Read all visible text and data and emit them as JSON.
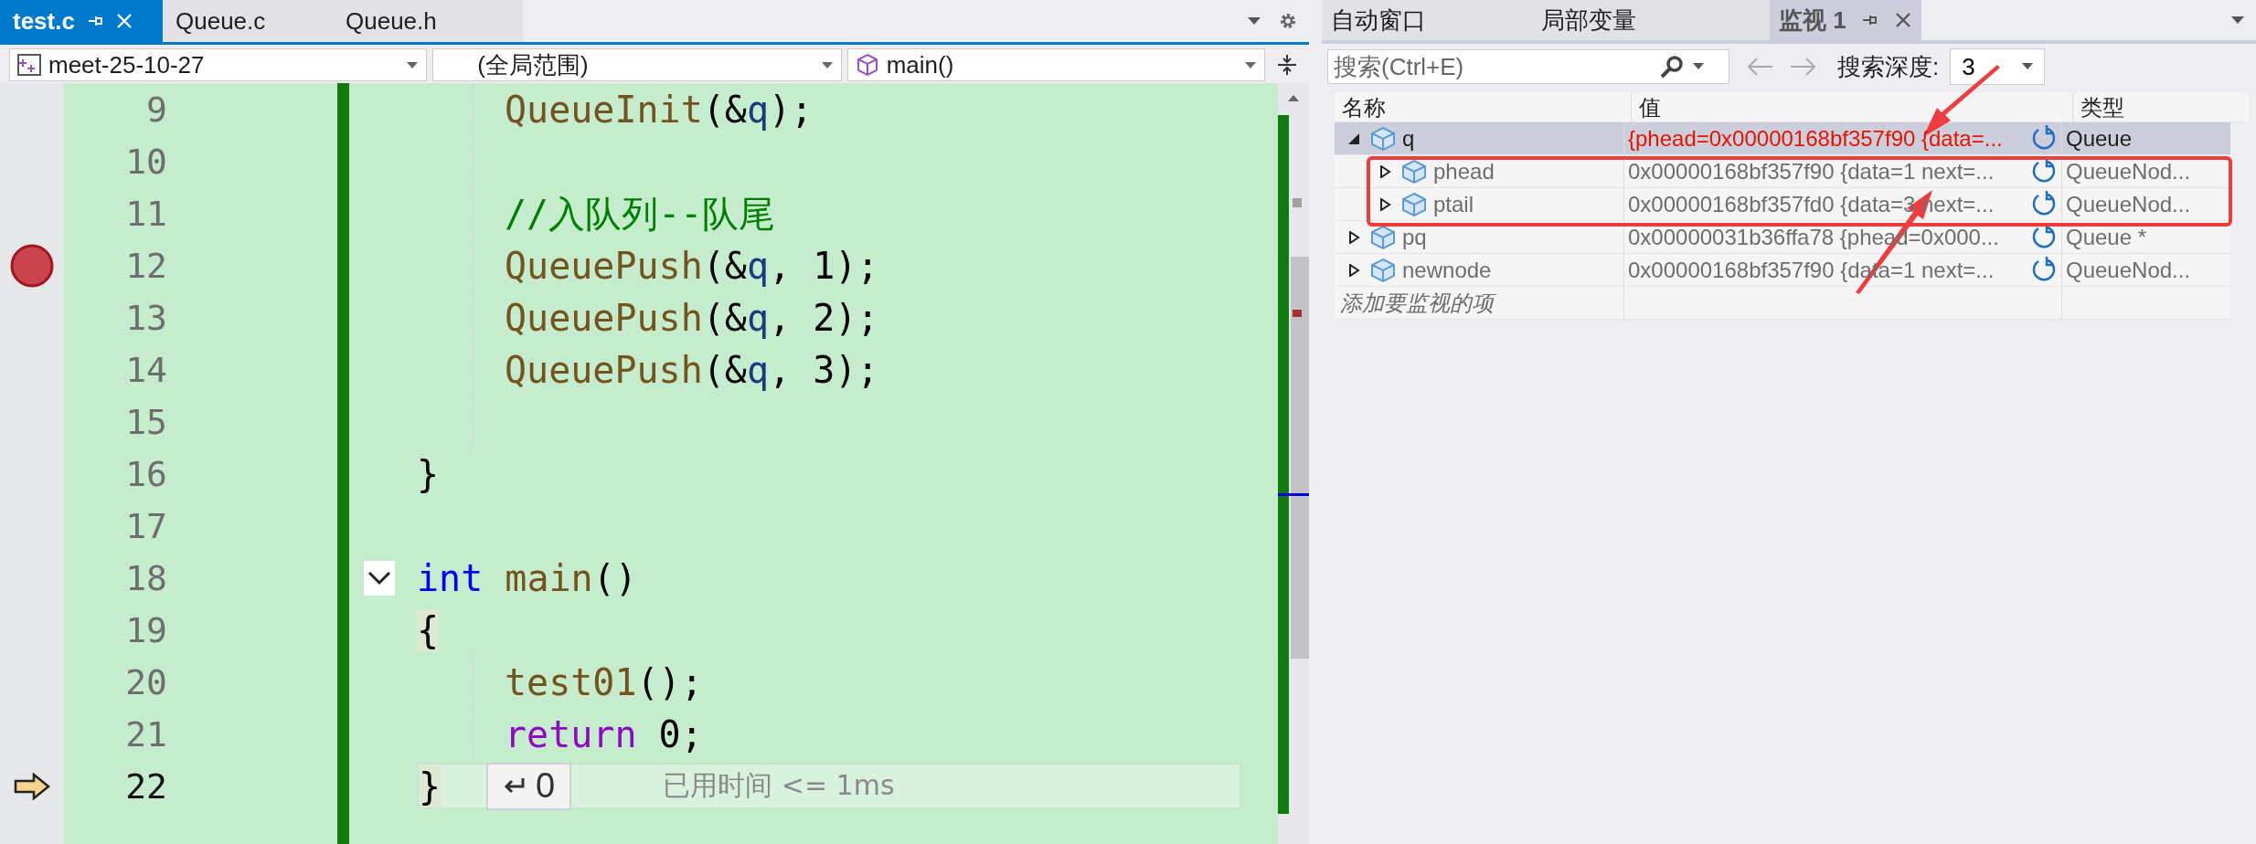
{
  "editor": {
    "tabs": [
      {
        "label": "test.c",
        "selected": true
      },
      {
        "label": "Queue.c",
        "selected": false
      },
      {
        "label": "Queue.h",
        "selected": false
      }
    ],
    "nav": {
      "project": "meet-25-10-27",
      "scope": "(全局范围)",
      "member": "main()"
    },
    "lines": [
      {
        "number": "9",
        "indented": true,
        "tokens": [
          {
            "kind": "func",
            "text": "QueueInit"
          },
          {
            "kind": "plain",
            "text": "(&"
          },
          {
            "kind": "var",
            "text": "q"
          },
          {
            "kind": "plain",
            "text": ");"
          }
        ]
      },
      {
        "number": "10",
        "indented": true
      },
      {
        "number": "11",
        "indented": true,
        "tokens": [
          {
            "kind": "comment",
            "text": "//入队列--队尾"
          }
        ]
      },
      {
        "number": "12",
        "indented": true,
        "breakpoint": true,
        "tokens": [
          {
            "kind": "func",
            "text": "QueuePush"
          },
          {
            "kind": "plain",
            "text": "(&"
          },
          {
            "kind": "var",
            "text": "q"
          },
          {
            "kind": "plain",
            "text": ", 1);"
          }
        ]
      },
      {
        "number": "13",
        "indented": true,
        "tokens": [
          {
            "kind": "func",
            "text": "QueuePush"
          },
          {
            "kind": "plain",
            "text": "(&"
          },
          {
            "kind": "var",
            "text": "q"
          },
          {
            "kind": "plain",
            "text": ", 2);"
          }
        ]
      },
      {
        "number": "14",
        "indented": true,
        "tokens": [
          {
            "kind": "func",
            "text": "QueuePush"
          },
          {
            "kind": "plain",
            "text": "(&"
          },
          {
            "kind": "var",
            "text": "q"
          },
          {
            "kind": "plain",
            "text": ", 3);"
          }
        ]
      },
      {
        "number": "15",
        "indented": true
      },
      {
        "number": "16",
        "indented": false,
        "tokens": [
          {
            "kind": "plain",
            "text": "}"
          }
        ]
      },
      {
        "number": "17",
        "indented": false
      },
      {
        "number": "18",
        "indented": false,
        "collapsible": true,
        "tokens": [
          {
            "kind": "keyword",
            "text": "int"
          },
          {
            "kind": "func",
            "text": "main",
            "spaced": true
          },
          {
            "kind": "plain",
            "text": "()"
          }
        ]
      },
      {
        "number": "19",
        "indented": false,
        "tokens": [
          {
            "kind": "brace",
            "text": "{"
          }
        ]
      },
      {
        "number": "20",
        "indented": true,
        "tokens": [
          {
            "kind": "func",
            "text": "test01"
          },
          {
            "kind": "plain",
            "text": "();"
          }
        ]
      },
      {
        "number": "21",
        "indented": true,
        "tokens": [
          {
            "kind": "control",
            "text": "return"
          },
          {
            "kind": "plain",
            "text": " 0;"
          }
        ]
      },
      {
        "number": "22",
        "indented": false,
        "current": true,
        "tokens": [
          {
            "kind": "brace",
            "text": "}"
          }
        ],
        "return_value": "0",
        "elapsed": "已用时间 <= 1ms"
      }
    ]
  },
  "watch": {
    "tabs": [
      {
        "label": "自动窗口",
        "selected": false
      },
      {
        "label": "局部变量",
        "selected": false
      },
      {
        "label": "监视 1",
        "selected": true
      }
    ],
    "search": {
      "placeholder": "搜索(Ctrl+E)"
    },
    "depth_label": "搜索深度:",
    "depth": "3",
    "columns": [
      "名称",
      "值",
      "类型"
    ],
    "rows": [
      {
        "name": "q",
        "value": "{phead=0x00000168bf357f90 {data=...",
        "type": "Queue",
        "expanded": true,
        "selected": true,
        "changed": true,
        "children": [
          {
            "name": "phead",
            "value": "0x00000168bf357f90 {data=1 next=...",
            "type": "QueueNod...",
            "expanded": false,
            "selected": false,
            "changed": false
          },
          {
            "name": "ptail",
            "value": "0x00000168bf357fd0 {data=3 next=...",
            "type": "QueueNod...",
            "expanded": false,
            "selected": false,
            "changed": false
          }
        ]
      },
      {
        "name": "pq",
        "value": "0x00000031b36ffa78 {phead=0x000...",
        "type": "Queue *",
        "expanded": false,
        "selected": false,
        "changed": false
      },
      {
        "name": "newnode",
        "value": "0x00000168bf357f90 {data=1 next=...",
        "type": "QueueNod...",
        "expanded": false,
        "selected": false,
        "changed": false
      }
    ],
    "add_hint": "添加要监视的项"
  },
  "markup": [
    {
      "kind": "box"
    },
    {
      "kind": "arrow-down"
    },
    {
      "kind": "arrow-up"
    }
  ]
}
